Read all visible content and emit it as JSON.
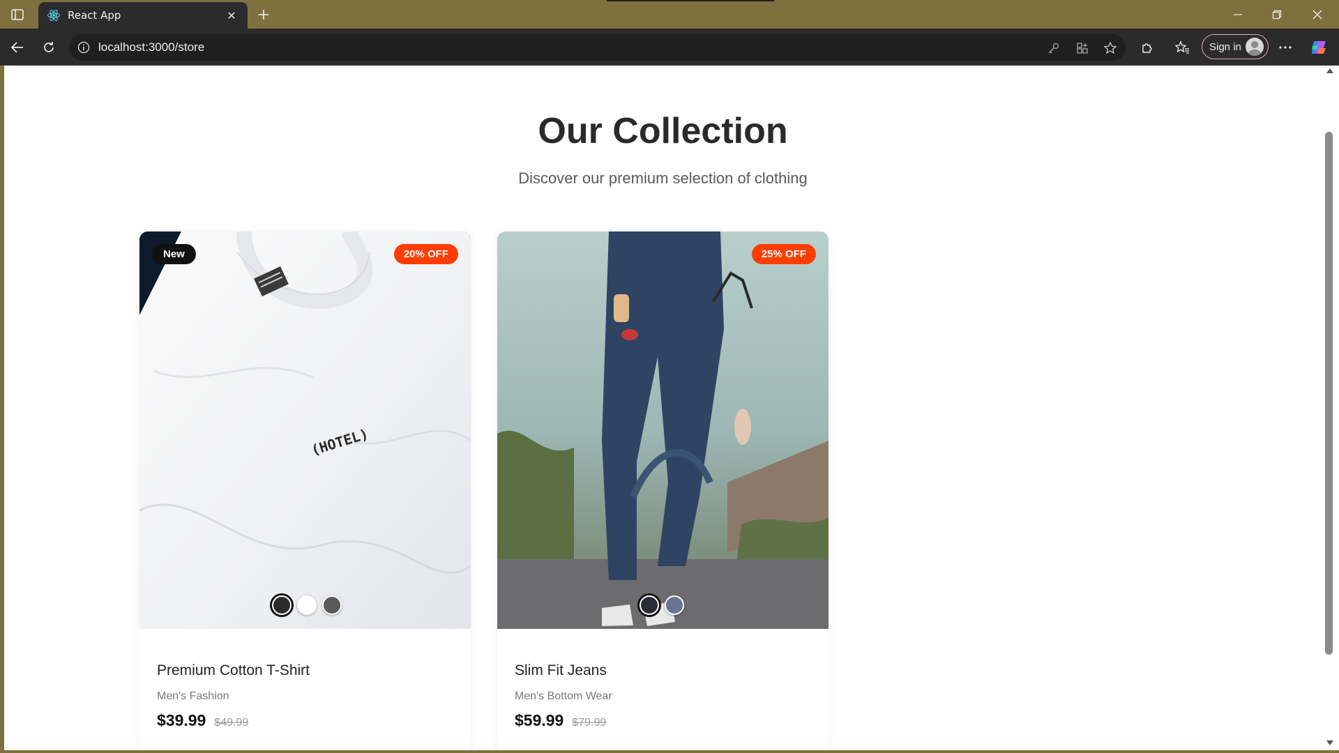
{
  "browser": {
    "tab_title": "React App",
    "url": "localhost:3000/store",
    "signin_label": "Sign in"
  },
  "page": {
    "title": "Our Collection",
    "subtitle": "Discover our premium selection of clothing"
  },
  "products": [
    {
      "name": "Premium Cotton T-Shirt",
      "category": "Men's Fashion",
      "price": "$39.99",
      "old_price": "$49.99",
      "badge_new": "New",
      "badge_discount": "20% OFF",
      "print_text": "(HOTEL)",
      "swatches": [
        "#2b2b2b",
        "#ffffff",
        "#5a5a5a"
      ],
      "selected_swatch": 0
    },
    {
      "name": "Slim Fit Jeans",
      "category": "Men's Bottom Wear",
      "price": "$59.99",
      "old_price": "$79.99",
      "badge_discount": "25% OFF",
      "swatches": [
        "#2b2b35",
        "#6b7391"
      ],
      "selected_swatch": 0
    }
  ],
  "colors": {
    "discount_badge": "#ff3d00",
    "new_badge": "#111111",
    "chrome_frame": "#7f7040"
  }
}
